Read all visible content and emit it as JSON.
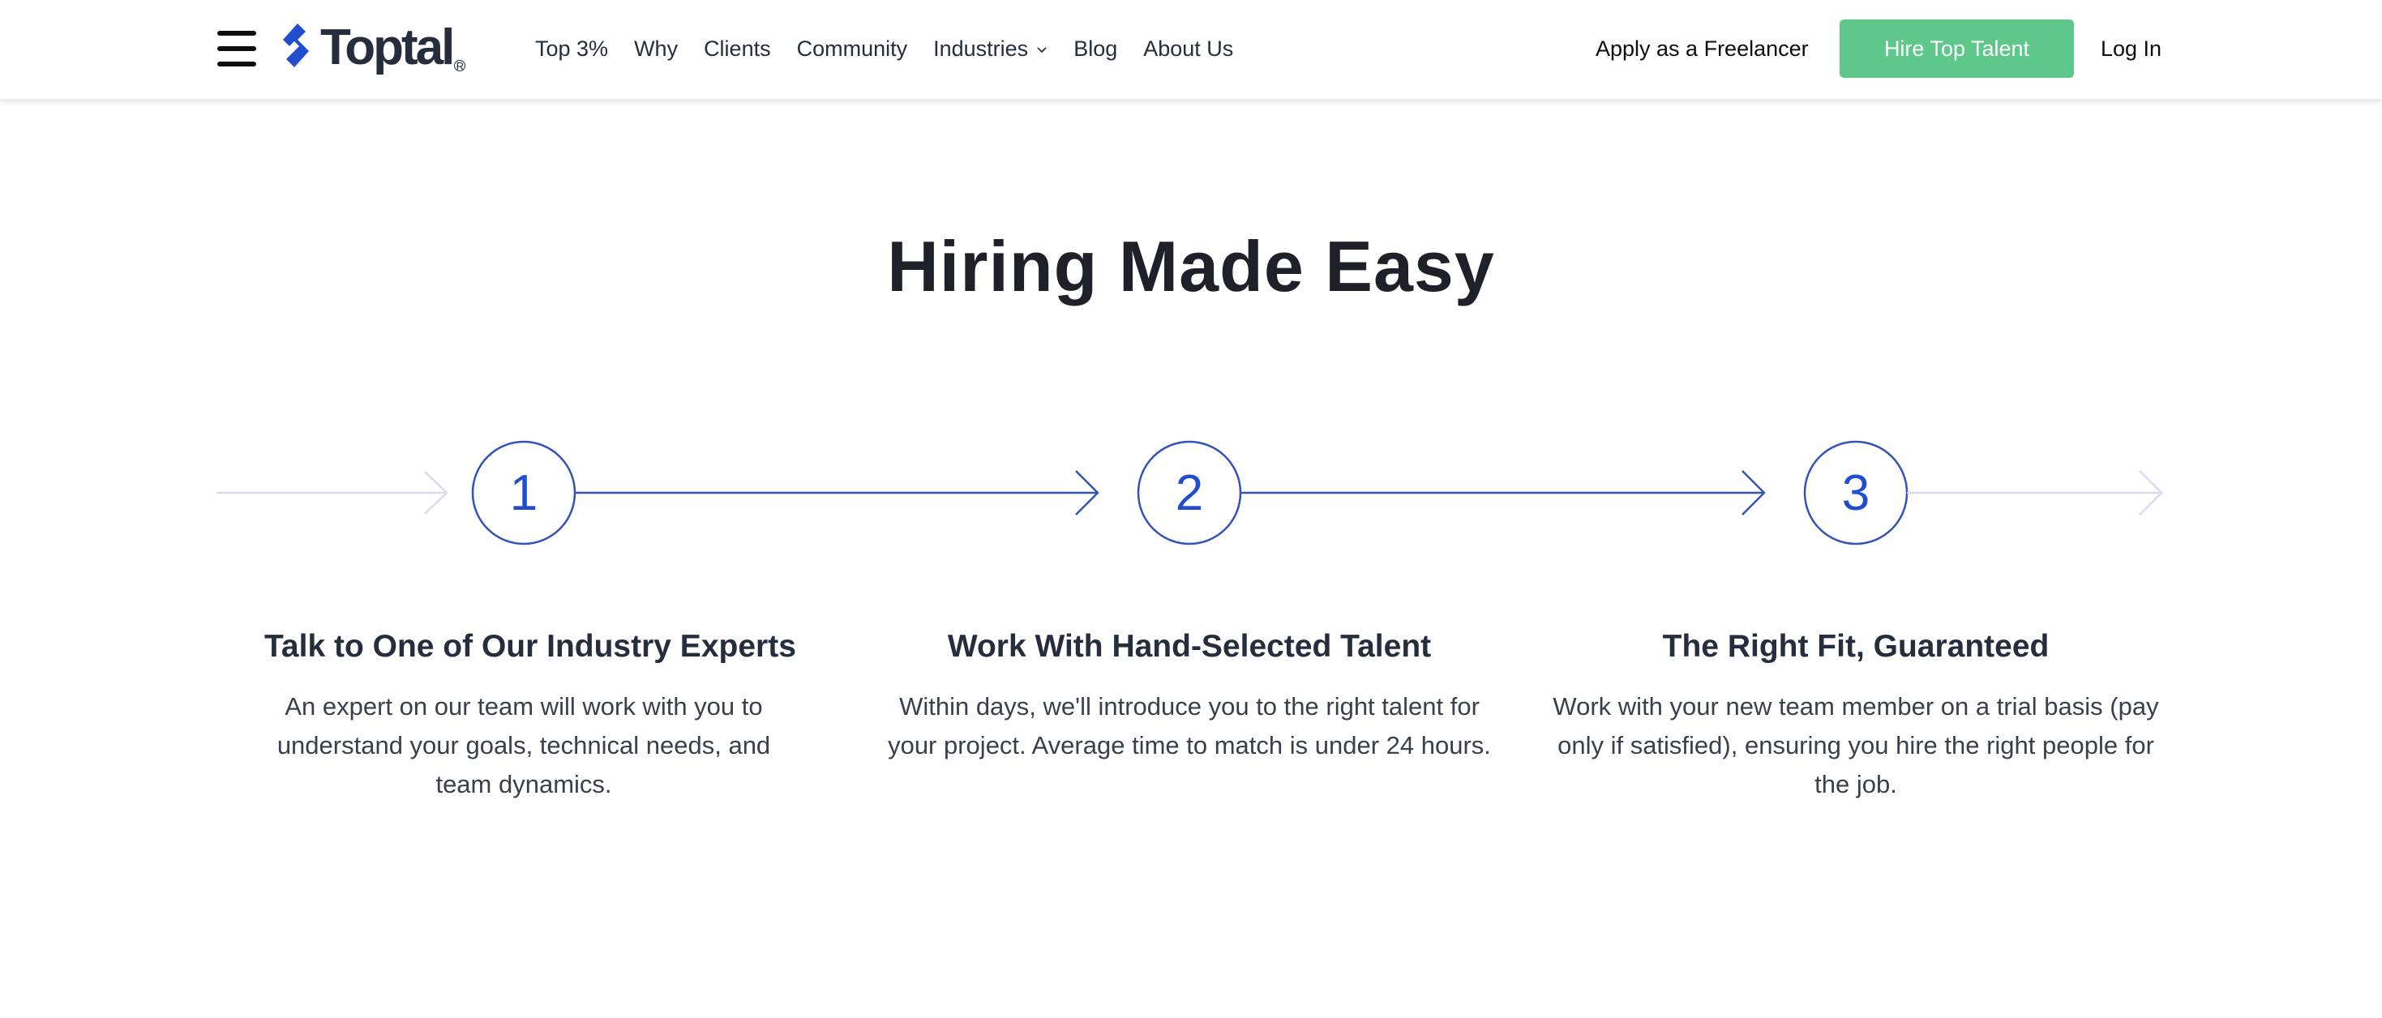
{
  "header": {
    "logo_text": "Toptal",
    "logo_reg": "R",
    "nav": [
      {
        "label": "Top 3%"
      },
      {
        "label": "Why"
      },
      {
        "label": "Clients"
      },
      {
        "label": "Community"
      },
      {
        "label": "Industries",
        "has_dropdown": true
      },
      {
        "label": "Blog"
      },
      {
        "label": "About Us"
      }
    ],
    "apply_label": "Apply as a Freelancer",
    "hire_label": "Hire Top Talent",
    "login_label": "Log In"
  },
  "colors": {
    "brand_blue": "#204ecf",
    "cta_green": "#5dc88a",
    "faded_arrow": "#d8dbef",
    "text_dark": "#262d3d"
  },
  "section": {
    "title": "Hiring Made Easy",
    "steps": [
      {
        "number": "1",
        "heading": "Talk to One of Our Industry Experts",
        "body": "An expert on our team will work with you to understand your goals, technical needs, and team dynamics."
      },
      {
        "number": "2",
        "heading": "Work With Hand-Selected Talent",
        "body": "Within days, we'll introduce you to the right talent for your project. Average time to match is under 24 hours."
      },
      {
        "number": "3",
        "heading": "The Right Fit, Guaranteed",
        "body": "Work with your new team member on a trial basis (pay only if satisfied), ensuring you hire the right people for the job."
      }
    ]
  }
}
